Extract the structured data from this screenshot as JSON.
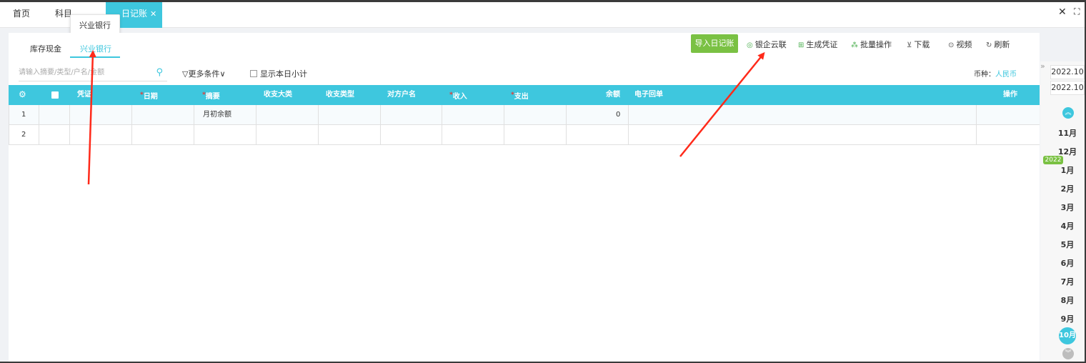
{
  "top_tabs": [
    {
      "label": "首页"
    },
    {
      "label": "科目"
    },
    {
      "label": "日记账"
    }
  ],
  "tooltip": "兴业银行",
  "sub_tabs": [
    {
      "label": "库存现金"
    },
    {
      "label": "兴业银行"
    }
  ],
  "toolbar": {
    "import": "导入日记账",
    "bank_link": "银企云联",
    "gen_voucher": "生成凭证",
    "batch": "批量操作",
    "download": "下载",
    "video": "视频",
    "refresh": "刷新"
  },
  "search": {
    "placeholder": "请输入摘要/类型/户名/金额",
    "more_conditions": "更多条件",
    "show_daily_subtotal": "显示本日小计",
    "currency_label": "币种：",
    "currency_value": "人民币"
  },
  "table": {
    "headers": [
      "凭证",
      "日期",
      "摘要",
      "收支大类",
      "收支类型",
      "对方户名",
      "收入",
      "支出",
      "余额",
      "电子回单",
      "操作"
    ],
    "rows": [
      {
        "no": "1",
        "summary": "月初余额",
        "balance": "0"
      },
      {
        "no": "2",
        "summary": "",
        "balance": ""
      }
    ]
  },
  "side": {
    "periods": [
      "2022.10",
      "2022.10"
    ],
    "year": "2022",
    "months": [
      "11月",
      "12月",
      "1月",
      "2月",
      "3月",
      "4月",
      "5月",
      "6月",
      "7月",
      "8月",
      "9月",
      "10月"
    ]
  },
  "colors": {
    "accent": "#3ec7de",
    "primary_button": "#7ac143",
    "arrow": "#ff2a1a"
  }
}
